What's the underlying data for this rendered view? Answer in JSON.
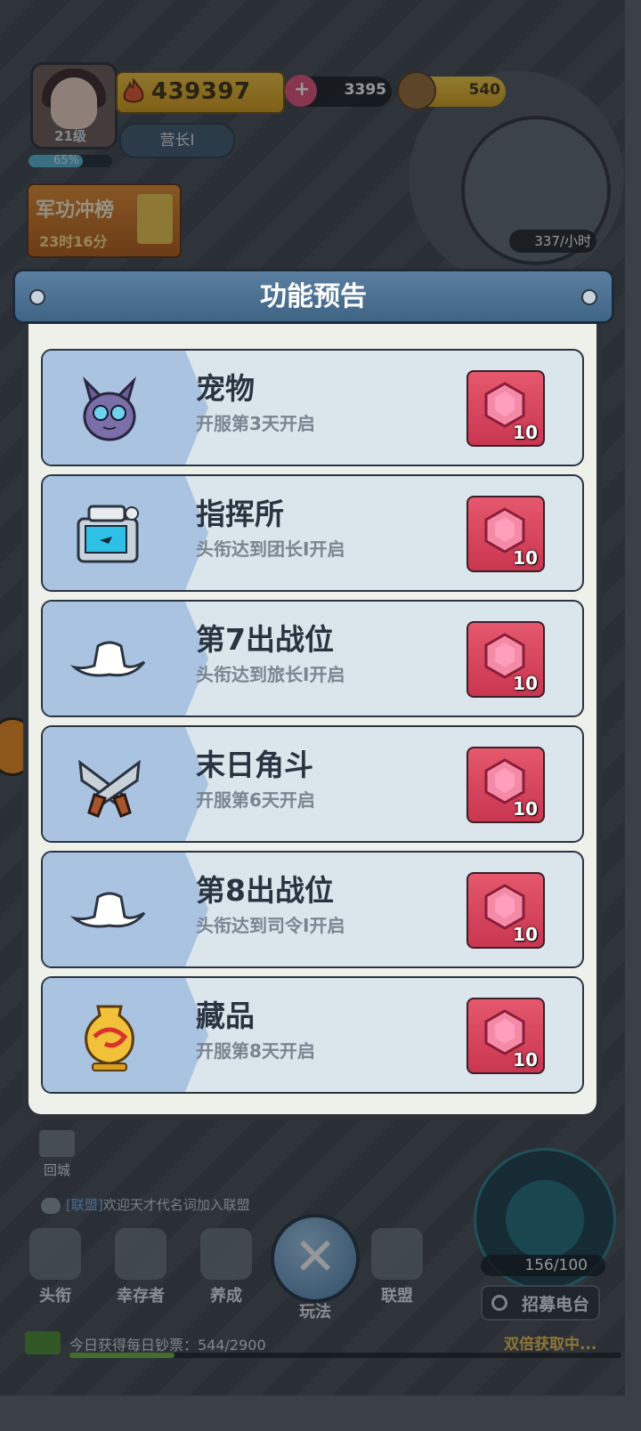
{
  "hud": {
    "player_level": "21级",
    "exp_percent_label": "65%",
    "exp_percent": 65,
    "power": "439397",
    "rank_title": "营长I",
    "gems": "3395",
    "gold": "540",
    "production_rate": "337/小时",
    "rank_board": {
      "title": "军功冲榜",
      "timer": "23时16分"
    }
  },
  "dialog": {
    "title": "功能预告",
    "features": [
      {
        "name": "宠物",
        "condition": "开服第3天开启",
        "icon": "pet-icon",
        "reward_qty": "10"
      },
      {
        "name": "指挥所",
        "condition": "头衔达到团长I开启",
        "icon": "command-post-icon",
        "reward_qty": "10"
      },
      {
        "name": "第7出战位",
        "condition": "头衔达到旅长I开启",
        "icon": "cowboy-hat-icon",
        "reward_qty": "10"
      },
      {
        "name": "末日角斗",
        "condition": "开服第6天开启",
        "icon": "crossed-revolvers-icon",
        "reward_qty": "10"
      },
      {
        "name": "第8出战位",
        "condition": "头衔达到司令I开启",
        "icon": "cowboy-hat-icon",
        "reward_qty": "10"
      },
      {
        "name": "藏品",
        "condition": "开服第8天开启",
        "icon": "golden-vase-icon",
        "reward_qty": "10"
      }
    ]
  },
  "bottom": {
    "home_label": "回城",
    "chat": {
      "tag": "[联盟]",
      "message": "欢迎天才代名词加入联盟"
    },
    "nav": [
      {
        "label": "头衔"
      },
      {
        "label": "幸存者"
      },
      {
        "label": "养成"
      },
      {
        "label": "玩法"
      },
      {
        "label": "联盟"
      }
    ],
    "troops": "156/100",
    "recruit_label": "招募电台",
    "daily_label": "今日获得每日钞票：544/2900",
    "daily_progress": 0.19,
    "double_label": "双倍获取中..."
  },
  "colors": {
    "accent_header": "#4a6f92",
    "reward_red": "#d9475e",
    "card_bg": "#dbe5ec",
    "icon_bg": "#a9c3e1"
  }
}
